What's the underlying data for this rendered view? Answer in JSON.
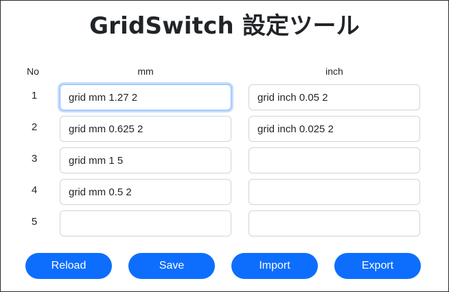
{
  "app": {
    "title": "GridSwitch 設定ツール"
  },
  "table": {
    "headers": {
      "no": "No",
      "mm": "mm",
      "inch": "inch"
    },
    "rows": [
      {
        "no": "1",
        "mm": "grid mm 1.27 2",
        "inch": "grid inch 0.05 2"
      },
      {
        "no": "2",
        "mm": "grid mm 0.625 2",
        "inch": "grid inch 0.025 2"
      },
      {
        "no": "3",
        "mm": "grid mm 1 5",
        "inch": ""
      },
      {
        "no": "4",
        "mm": "grid mm 0.5 2",
        "inch": ""
      },
      {
        "no": "5",
        "mm": "",
        "inch": ""
      }
    ]
  },
  "buttons": {
    "reload": "Reload",
    "save": "Save",
    "import": "Import",
    "export": "Export"
  },
  "colors": {
    "accent": "#0d6efd",
    "focus_ring": "#86b7fe",
    "border": "#ced4da",
    "text": "#212529"
  }
}
